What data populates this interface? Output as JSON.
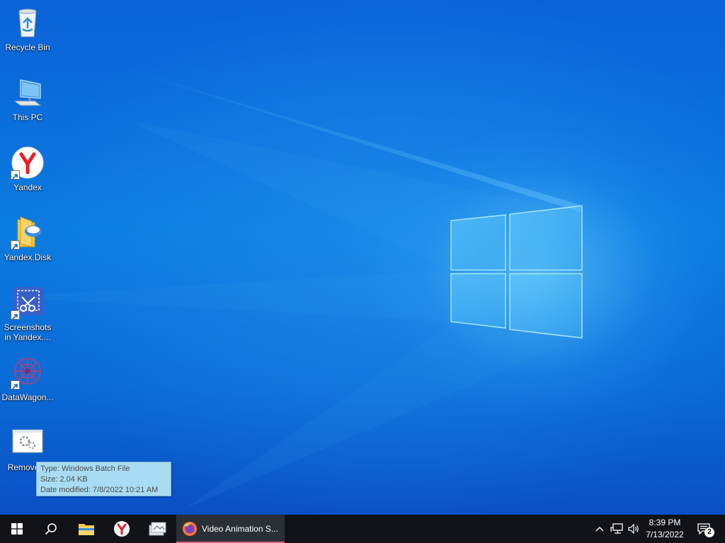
{
  "desktop": {
    "icons": [
      {
        "label": "Recycle Bin",
        "icon": "recycle-bin-icon"
      },
      {
        "label": "This PC",
        "icon": "computer-icon"
      },
      {
        "label": "Yandex",
        "icon": "yandex-browser-icon"
      },
      {
        "label": "Yandex.Disk",
        "icon": "yandex-disk-folder-icon"
      },
      {
        "label": "Screenshots in Yandex....",
        "icon": "screenshot-scissors-icon"
      },
      {
        "label": "DataWagon...",
        "icon": "datawagon-icon"
      },
      {
        "label": "Remove-E",
        "icon": "batch-file-icon"
      }
    ]
  },
  "tooltip": {
    "type": "Type: Windows Batch File",
    "size": "Size: 2.04 KB",
    "modified": "Date modified: 7/8/2022 10:21 AM"
  },
  "taskbar": {
    "active_app_title": "Video Animation S...",
    "active_app_icon": "firefox-icon",
    "pinned": [
      "file-explorer-icon",
      "yandex-browser-icon",
      "app-icon"
    ]
  },
  "tray": {
    "time": "8:39 PM",
    "date": "7/13/2022",
    "notification_count": "2"
  },
  "colors": {
    "taskbar": "#101418",
    "accent": "#e45d75",
    "tooltip_bg": "#a8dcf3"
  }
}
